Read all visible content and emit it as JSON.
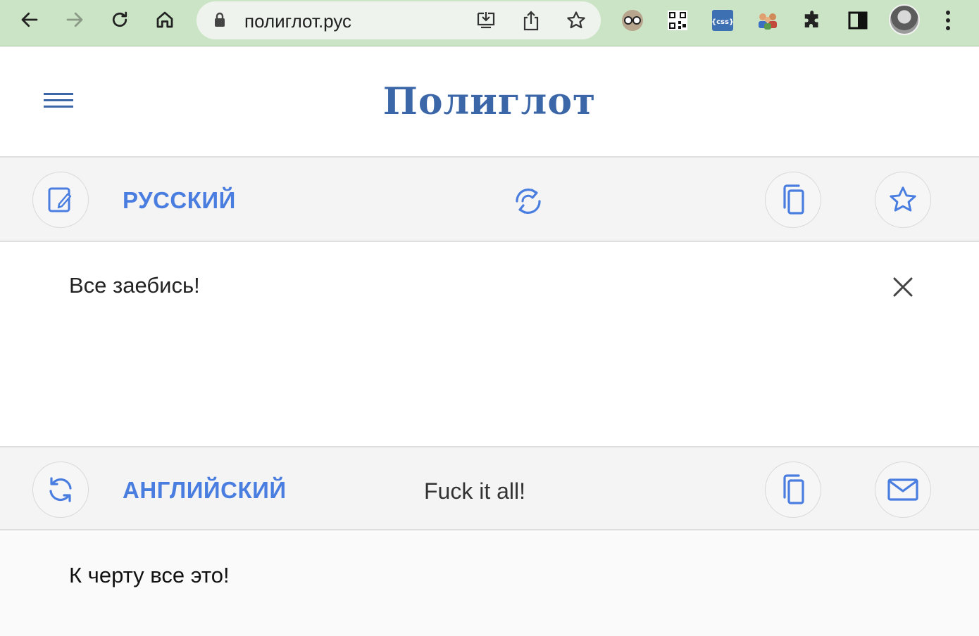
{
  "browser": {
    "url": "полиглот.рус",
    "icons": {
      "back": "arrow-left-icon",
      "forward": "arrow-right-icon",
      "reload": "reload-icon",
      "home": "home-icon",
      "lock": "lock-icon",
      "install": "install-app-icon",
      "share": "share-icon",
      "bookmark": "star-outline-icon",
      "extensions": [
        "glasses-extension-icon",
        "qr-code-extension-icon",
        "css-extension-icon",
        "people-extension-icon",
        "puzzle-icon",
        "sidebar-icon"
      ],
      "menu": "kebab-menu-icon"
    },
    "colors": {
      "toolbar": "#cce4c6",
      "omnibox": "#eef4ed"
    }
  },
  "site": {
    "logo": "Полиглот",
    "menu_icon": "hamburger-icon",
    "accent_color": "#4a7de0",
    "logo_color": "#3b67a8"
  },
  "source": {
    "language": "РУССКИЙ",
    "text": "Все заебись!",
    "icons": {
      "left": "edit-note-icon",
      "swap": "swap-languages-icon",
      "copy": "copy-icon",
      "favorite": "star-outline-icon",
      "clear": "close-icon"
    }
  },
  "target": {
    "language": "АНГЛИЙСКИЙ",
    "translation": "Fuck it all!",
    "back_translation": "К черту все это!",
    "icons": {
      "left": "refresh-icon",
      "copy": "copy-icon",
      "mail": "mail-icon"
    }
  }
}
